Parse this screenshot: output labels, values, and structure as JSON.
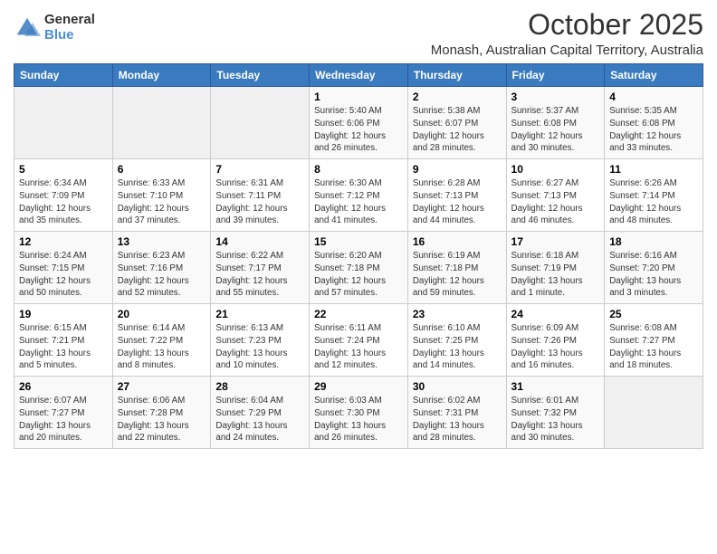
{
  "logo": {
    "general": "General",
    "blue": "Blue"
  },
  "header": {
    "title": "October 2025",
    "subtitle": "Monash, Australian Capital Territory, Australia"
  },
  "days_of_week": [
    "Sunday",
    "Monday",
    "Tuesday",
    "Wednesday",
    "Thursday",
    "Friday",
    "Saturday"
  ],
  "weeks": [
    [
      {
        "day": "",
        "info": ""
      },
      {
        "day": "",
        "info": ""
      },
      {
        "day": "",
        "info": ""
      },
      {
        "day": "1",
        "info": "Sunrise: 5:40 AM\nSunset: 6:06 PM\nDaylight: 12 hours and 26 minutes."
      },
      {
        "day": "2",
        "info": "Sunrise: 5:38 AM\nSunset: 6:07 PM\nDaylight: 12 hours and 28 minutes."
      },
      {
        "day": "3",
        "info": "Sunrise: 5:37 AM\nSunset: 6:08 PM\nDaylight: 12 hours and 30 minutes."
      },
      {
        "day": "4",
        "info": "Sunrise: 5:35 AM\nSunset: 6:08 PM\nDaylight: 12 hours and 33 minutes."
      }
    ],
    [
      {
        "day": "5",
        "info": "Sunrise: 6:34 AM\nSunset: 7:09 PM\nDaylight: 12 hours and 35 minutes."
      },
      {
        "day": "6",
        "info": "Sunrise: 6:33 AM\nSunset: 7:10 PM\nDaylight: 12 hours and 37 minutes."
      },
      {
        "day": "7",
        "info": "Sunrise: 6:31 AM\nSunset: 7:11 PM\nDaylight: 12 hours and 39 minutes."
      },
      {
        "day": "8",
        "info": "Sunrise: 6:30 AM\nSunset: 7:12 PM\nDaylight: 12 hours and 41 minutes."
      },
      {
        "day": "9",
        "info": "Sunrise: 6:28 AM\nSunset: 7:13 PM\nDaylight: 12 hours and 44 minutes."
      },
      {
        "day": "10",
        "info": "Sunrise: 6:27 AM\nSunset: 7:13 PM\nDaylight: 12 hours and 46 minutes."
      },
      {
        "day": "11",
        "info": "Sunrise: 6:26 AM\nSunset: 7:14 PM\nDaylight: 12 hours and 48 minutes."
      }
    ],
    [
      {
        "day": "12",
        "info": "Sunrise: 6:24 AM\nSunset: 7:15 PM\nDaylight: 12 hours and 50 minutes."
      },
      {
        "day": "13",
        "info": "Sunrise: 6:23 AM\nSunset: 7:16 PM\nDaylight: 12 hours and 52 minutes."
      },
      {
        "day": "14",
        "info": "Sunrise: 6:22 AM\nSunset: 7:17 PM\nDaylight: 12 hours and 55 minutes."
      },
      {
        "day": "15",
        "info": "Sunrise: 6:20 AM\nSunset: 7:18 PM\nDaylight: 12 hours and 57 minutes."
      },
      {
        "day": "16",
        "info": "Sunrise: 6:19 AM\nSunset: 7:18 PM\nDaylight: 12 hours and 59 minutes."
      },
      {
        "day": "17",
        "info": "Sunrise: 6:18 AM\nSunset: 7:19 PM\nDaylight: 13 hours and 1 minute."
      },
      {
        "day": "18",
        "info": "Sunrise: 6:16 AM\nSunset: 7:20 PM\nDaylight: 13 hours and 3 minutes."
      }
    ],
    [
      {
        "day": "19",
        "info": "Sunrise: 6:15 AM\nSunset: 7:21 PM\nDaylight: 13 hours and 5 minutes."
      },
      {
        "day": "20",
        "info": "Sunrise: 6:14 AM\nSunset: 7:22 PM\nDaylight: 13 hours and 8 minutes."
      },
      {
        "day": "21",
        "info": "Sunrise: 6:13 AM\nSunset: 7:23 PM\nDaylight: 13 hours and 10 minutes."
      },
      {
        "day": "22",
        "info": "Sunrise: 6:11 AM\nSunset: 7:24 PM\nDaylight: 13 hours and 12 minutes."
      },
      {
        "day": "23",
        "info": "Sunrise: 6:10 AM\nSunset: 7:25 PM\nDaylight: 13 hours and 14 minutes."
      },
      {
        "day": "24",
        "info": "Sunrise: 6:09 AM\nSunset: 7:26 PM\nDaylight: 13 hours and 16 minutes."
      },
      {
        "day": "25",
        "info": "Sunrise: 6:08 AM\nSunset: 7:27 PM\nDaylight: 13 hours and 18 minutes."
      }
    ],
    [
      {
        "day": "26",
        "info": "Sunrise: 6:07 AM\nSunset: 7:27 PM\nDaylight: 13 hours and 20 minutes."
      },
      {
        "day": "27",
        "info": "Sunrise: 6:06 AM\nSunset: 7:28 PM\nDaylight: 13 hours and 22 minutes."
      },
      {
        "day": "28",
        "info": "Sunrise: 6:04 AM\nSunset: 7:29 PM\nDaylight: 13 hours and 24 minutes."
      },
      {
        "day": "29",
        "info": "Sunrise: 6:03 AM\nSunset: 7:30 PM\nDaylight: 13 hours and 26 minutes."
      },
      {
        "day": "30",
        "info": "Sunrise: 6:02 AM\nSunset: 7:31 PM\nDaylight: 13 hours and 28 minutes."
      },
      {
        "day": "31",
        "info": "Sunrise: 6:01 AM\nSunset: 7:32 PM\nDaylight: 13 hours and 30 minutes."
      },
      {
        "day": "",
        "info": ""
      }
    ]
  ]
}
